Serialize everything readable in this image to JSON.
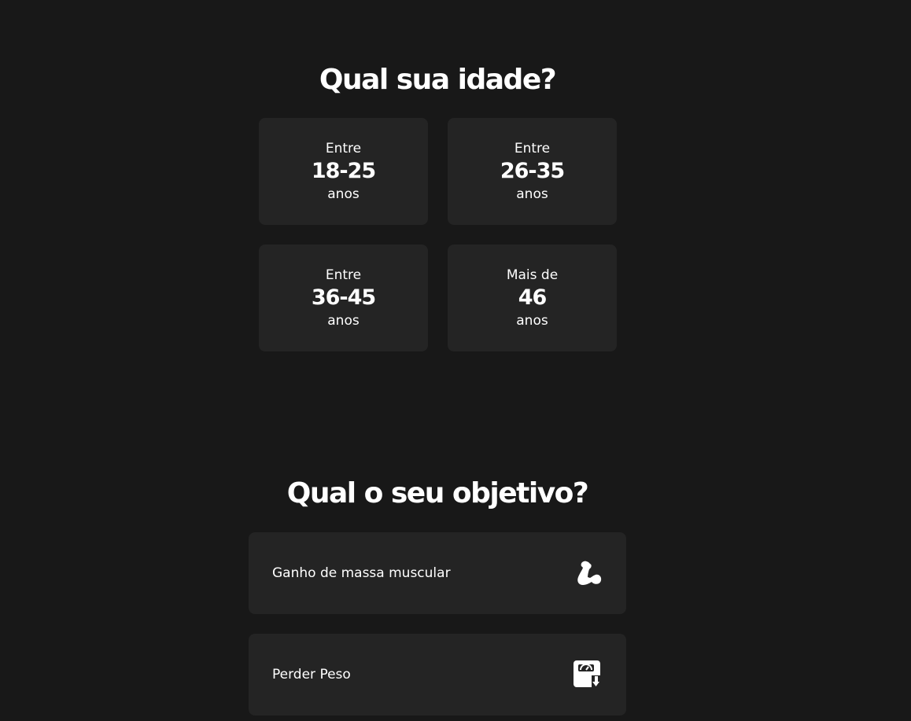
{
  "age": {
    "title": "Qual sua idade?",
    "options": [
      {
        "prefix": "Entre",
        "range": "18-25",
        "suffix": "anos"
      },
      {
        "prefix": "Entre",
        "range": "26-35",
        "suffix": "anos"
      },
      {
        "prefix": "Entre",
        "range": "36-45",
        "suffix": "anos"
      },
      {
        "prefix": "Mais de",
        "range": "46",
        "suffix": "anos"
      }
    ]
  },
  "goal": {
    "title": "Qual o seu objetivo?",
    "options": [
      {
        "label": "Ganho de massa muscular",
        "icon": "flexed-biceps-icon"
      },
      {
        "label": "Perder Peso",
        "icon": "weight-scale-icon"
      }
    ]
  },
  "colors": {
    "background": "#181818",
    "card": "#242424",
    "text": "#ffffff"
  }
}
